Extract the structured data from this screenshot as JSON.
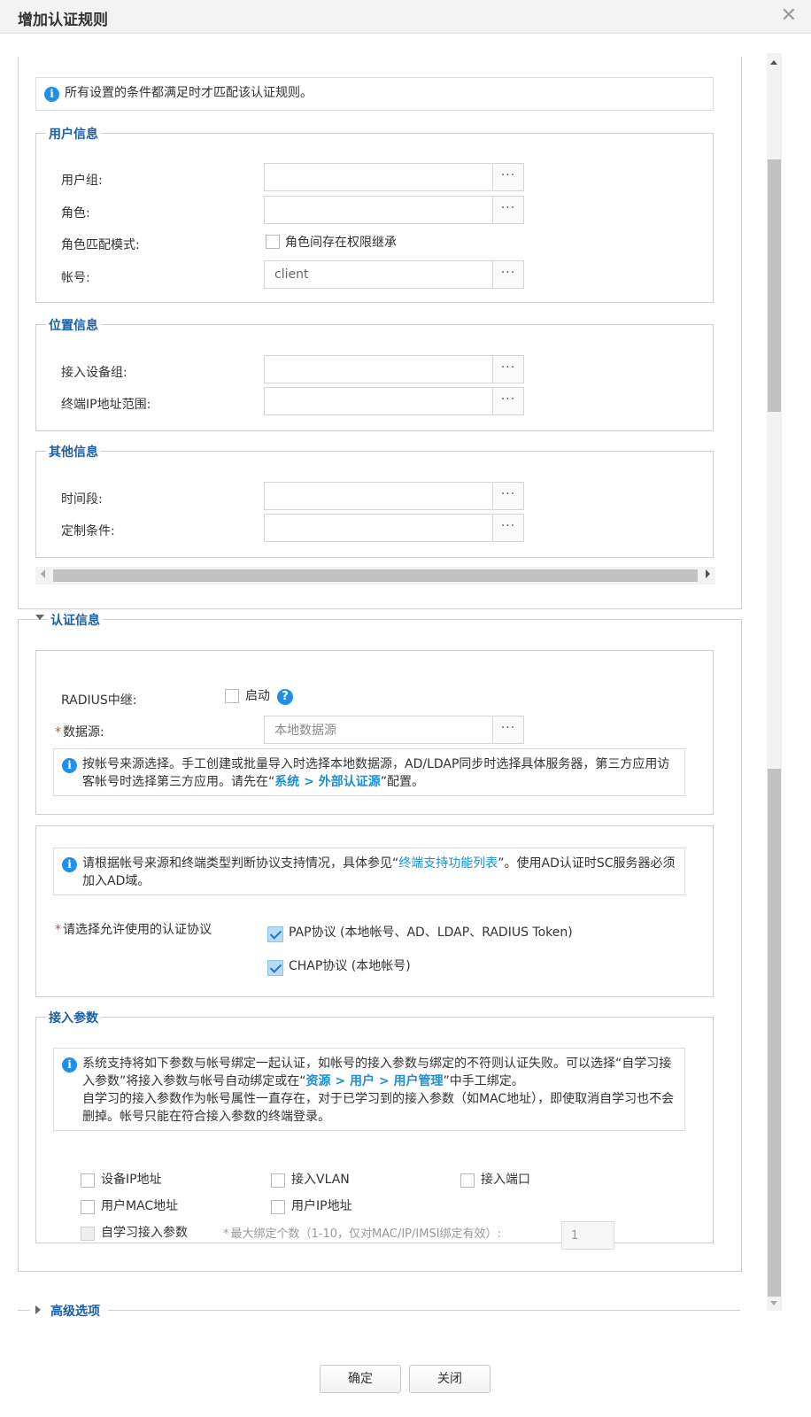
{
  "dialog": {
    "title": "增加认证规则",
    "close_glyph": "✕"
  },
  "top_info": "所有设置的条件都满足时才匹配该认证规则。",
  "user_info": {
    "legend": "用户信息",
    "user_group_label": "用户组:",
    "role_label": "角色:",
    "role_match_label": "角色匹配模式:",
    "role_match_option": "角色间存在权限继承",
    "account_label": "帐号:",
    "account_value": "client"
  },
  "location_info": {
    "legend": "位置信息",
    "device_group_label": "接入设备组:",
    "ip_range_label": "终端IP地址范围:"
  },
  "other_info": {
    "legend": "其他信息",
    "time_label": "时间段:",
    "custom_label": "定制条件:"
  },
  "dots": "···",
  "auth_info": {
    "legend": "认证信息",
    "radius_label": "RADIUS中继:",
    "radius_option": "启动",
    "help_glyph": "?",
    "datasource_required": "*",
    "datasource_label": "数据源:",
    "datasource_placeholder": "本地数据源",
    "datasource_info_1": "按帐号来源选择。手工创建或批量导入时选择本地数据源，AD/LDAP同步时选择具体服务器，第三方应用访客帐号时选择第三方应用。请先在“",
    "datasource_info_link": "系统 > 外部认证源",
    "datasource_info_2": "”配置。"
  },
  "protocol": {
    "info_1": "请根据帐号来源和终端类型判断协议支持情况，具体参见“",
    "info_link": "终端支持功能列表",
    "info_2": "”。使用AD认证时SC服务器必须加入AD域。",
    "required": "*",
    "label": "请选择允许使用的认证协议",
    "pap": "PAP协议 (本地帐号、AD、LDAP、RADIUS Token)",
    "chap": "CHAP协议 (本地帐号)"
  },
  "access_params": {
    "legend": "接入参数",
    "info_1": "系统支持将如下参数与帐号绑定一起认证，如帐号的接入参数与绑定的不符则认证失败。可以选择“自学习接入参数”将接入参数与帐号自动绑定或在“",
    "info_link": "资源 > 用户 > 用户管理",
    "info_2": "”中手工绑定。",
    "info_3": "自学习的接入参数作为帐号属性一直存在，对于已学习到的接入参数（如MAC地址），即使取消自学习也不会删掉。帐号只能在符合接入参数的终端登录。",
    "device_ip": "设备IP地址",
    "vlan": "接入VLAN",
    "port": "接入端口",
    "user_mac": "用户MAC地址",
    "user_ip": "用户IP地址",
    "self_learn": "自学习接入参数",
    "max_bind_required": "*",
    "max_bind_label": "最大绑定个数（1-10，仅对MAC/IP/IMSI绑定有效）:",
    "max_bind_value": "1"
  },
  "advanced": {
    "legend": "高级选项"
  },
  "footer": {
    "ok": "确定",
    "close": "关闭"
  },
  "colors": {
    "accent": "#1b8fd6",
    "legend": "#1a5fa6",
    "required": "#e23c3c"
  }
}
